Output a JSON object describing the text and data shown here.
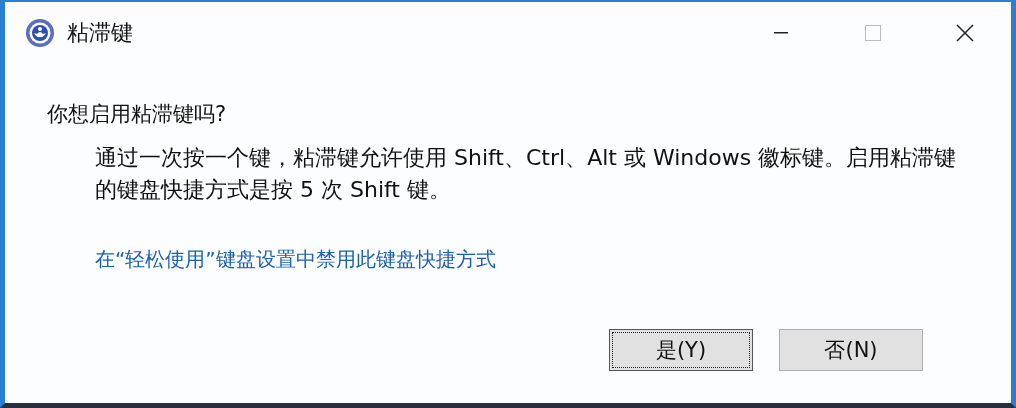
{
  "window": {
    "title": "粘滞键"
  },
  "question": "你想启用粘滞键吗?",
  "description": "通过一次按一个键，粘滞键允许使用 Shift、Ctrl、Alt 或 Windows 徽标键。启用粘滞键的键盘快捷方式是按 5 次 Shift 键。",
  "link": "在“轻松使用”键盘设置中禁用此键盘快捷方式",
  "buttons": [
    {
      "label": "是(Y)",
      "focused": true
    },
    {
      "label": "否(N)",
      "focused": false
    }
  ]
}
